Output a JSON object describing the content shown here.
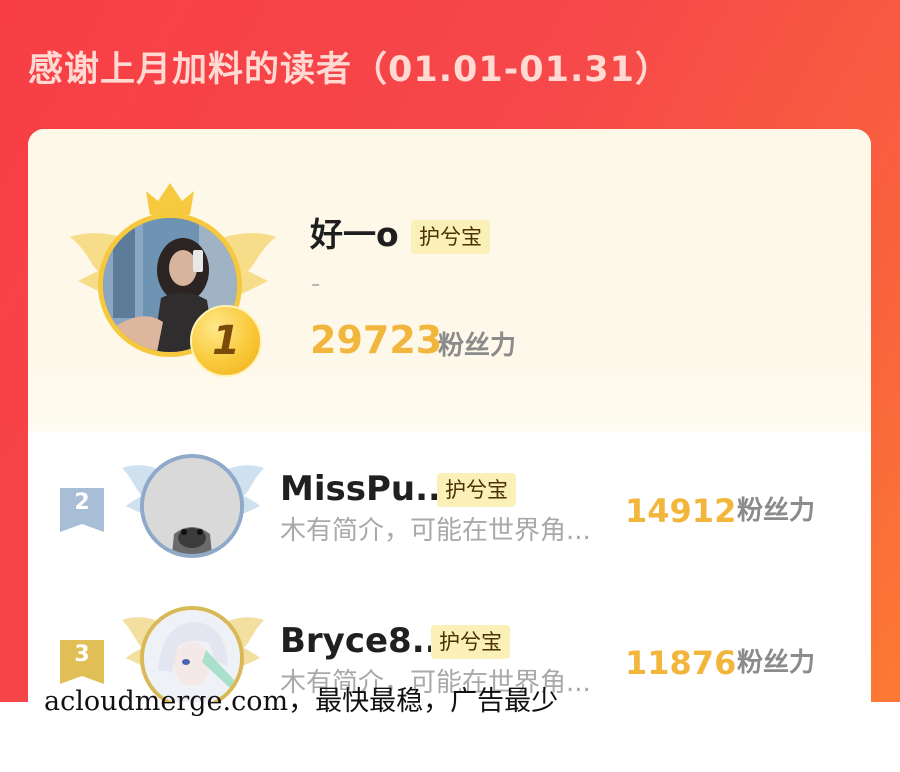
{
  "header": {
    "title": "感谢上月加料的读者（01.01-01.31）"
  },
  "top_reader": {
    "rank": "1",
    "name": "好一o",
    "badge": "护兮宝",
    "intro": "-",
    "score": "29723",
    "score_unit": "粉丝力"
  },
  "readers": [
    {
      "rank": "2",
      "name": "MissPu...",
      "badge": "护兮宝",
      "intro": "木有简介，可能在世界角...",
      "score": "14912",
      "score_unit": "粉丝力"
    },
    {
      "rank": "3",
      "name": "Bryce8...",
      "badge": "护兮宝",
      "intro": "木有简介，可能在世界角...",
      "score": "11876",
      "score_unit": "粉丝力"
    }
  ],
  "watermark": "acloudmerge.com，最快最稳，广告最少",
  "colors": {
    "banner": "#f6474a",
    "gold": "#f3b63c",
    "badge_bg": "#fbf0b8",
    "silver": "#a8bed6",
    "bronze": "#e2bf56"
  },
  "icons": {
    "crown": "crown-icon",
    "wings": "wings-icon",
    "medal": "medal-icon",
    "rank_ribbon": "ribbon-icon"
  }
}
